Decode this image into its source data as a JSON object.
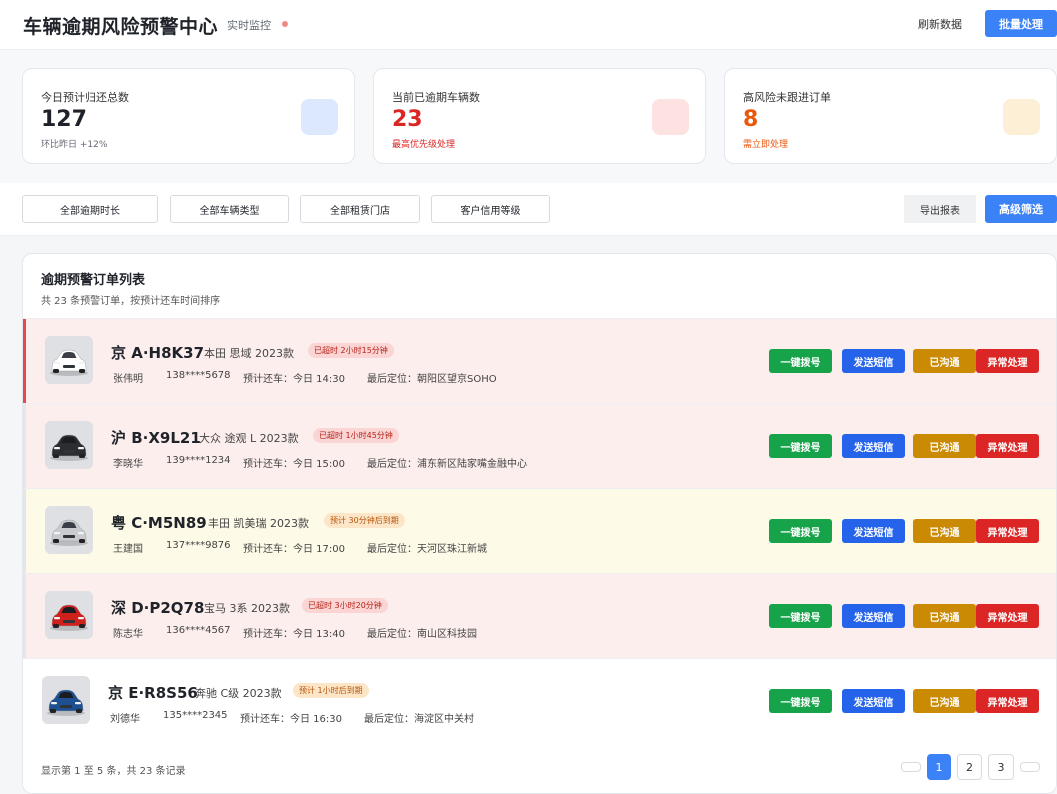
{
  "header": {
    "title": "车辆逾期风险预警中心",
    "live_label": "实时监控",
    "refresh_label": "刷新数据",
    "batch_label": "批量处理"
  },
  "stats": [
    {
      "label": "今日预计归还总数",
      "value": "127",
      "sub": "环比昨日 +12%",
      "value_color": "#1f2329",
      "sub_color": "#646a73",
      "icon_bg": "#dbe8fd"
    },
    {
      "label": "当前已逾期车辆数",
      "value": "23",
      "sub": "最高优先级处理",
      "value_color": "#dc2626",
      "sub_color": "#dc2626",
      "icon_bg": "#fde2e2"
    },
    {
      "label": "高风险未跟进订单",
      "value": "8",
      "sub": "需立即处理",
      "value_color": "#ea580c",
      "sub_color": "#ea580c",
      "icon_bg": "#fdeed6"
    }
  ],
  "filters": {
    "items": [
      "全部逾期时长",
      "全部车辆类型",
      "全部租赁门店",
      "客户信用等级"
    ],
    "export_label": "导出报表",
    "advanced_label": "高级筛选"
  },
  "list": {
    "title": "逾期预警订单列表",
    "subtitle": "共 23 条预警订单，按预计还车时间排序",
    "actions": {
      "call": "一键拨号",
      "sms": "发送短信",
      "talked": "已沟通",
      "abnormal": "异常处理"
    },
    "rows": [
      {
        "plate": "京 A·H8K37",
        "model": "本田 思域 2023款",
        "badge": "已超时 2小时15分钟",
        "name": "张伟明",
        "phone": "138****5678",
        "expected": "预计还车：今日 14:30",
        "location": "最后定位：朝阳区望京SOHO",
        "car_color": "#ffffff"
      },
      {
        "plate": "沪 B·X9L21",
        "model": "大众 途观 L 2023款",
        "badge": "已超时 1小时45分钟",
        "name": "李晓华",
        "phone": "139****1234",
        "expected": "预计还车：今日 15:00",
        "location": "最后定位：浦东新区陆家嘴金融中心",
        "car_color": "#2b2d31"
      },
      {
        "plate": "粤 C·M5N89",
        "model": "丰田 凯美瑞 2023款",
        "badge": "预计 30分钟后到期",
        "name": "王建国",
        "phone": "137****9876",
        "expected": "预计还车：今日 17:00",
        "location": "最后定位：天河区珠江新城",
        "car_color": "#c9cbcf"
      },
      {
        "plate": "深 D·P2Q78",
        "model": "宝马 3系 2023款",
        "badge": "已超时 3小时20分钟",
        "name": "陈志华",
        "phone": "136****4567",
        "expected": "预计还车：今日 13:40",
        "location": "最后定位：南山区科技园",
        "car_color": "#d0201c"
      },
      {
        "plate": "京 E·R8S56",
        "model": "奔驰 C级 2023款",
        "badge": "预计 1小时后到期",
        "name": "刘德华",
        "phone": "135****2345",
        "expected": "预计还车：今日 16:30",
        "location": "最后定位：海淀区中关村",
        "car_color": "#1d4f91"
      }
    ],
    "footer": "显示第 1 至 5 条，共 23 条记录",
    "pages": [
      "1",
      "2",
      "3"
    ]
  }
}
